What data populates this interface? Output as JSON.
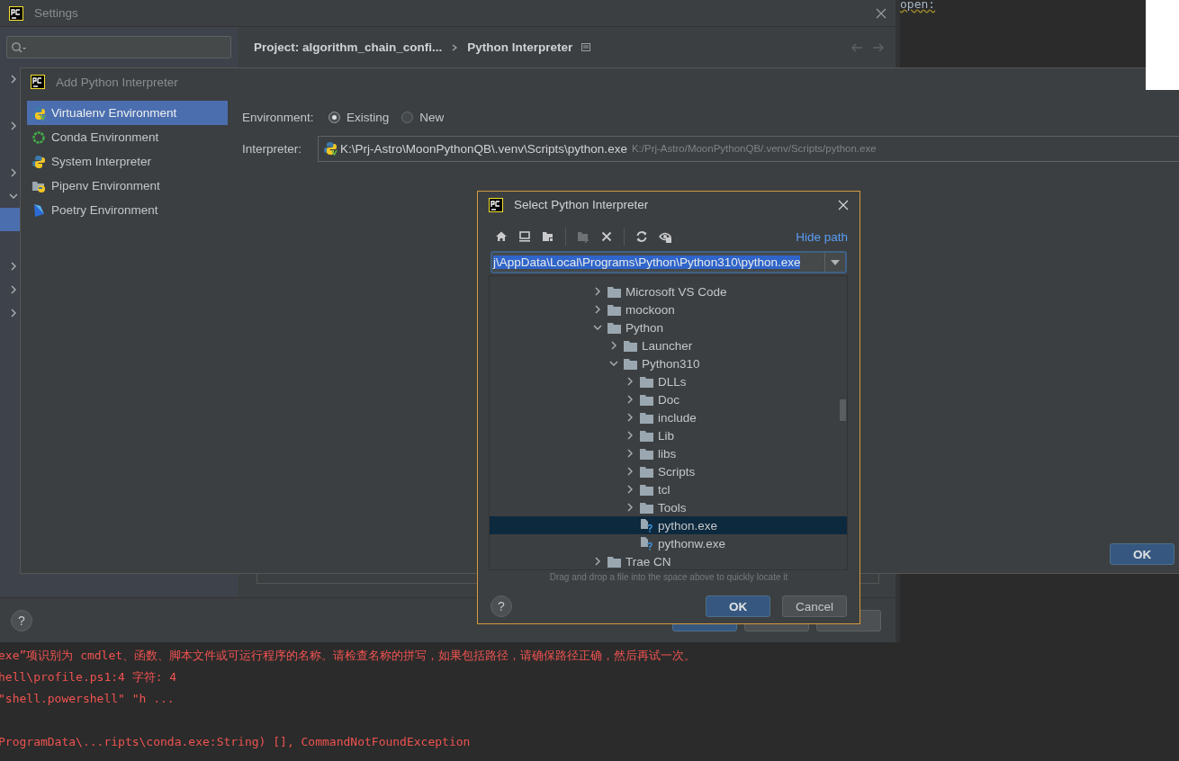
{
  "editor": {
    "code": "open:"
  },
  "terminal": {
    "paragraphs": [
      [
        "exe”项识别为 cmdlet、函数、脚本文件或可运行程序的名称。请检查名称的拼写，如果包括路径，请确保路径正确，然后再试一次。",
        "hell\\profile.ps1:4 字符: 4",
        "\"shell.powershell\" \"h ..."
      ],
      [
        "ProgramData\\...ripts\\conda.exe:String) [], CommandNotFoundException"
      ]
    ]
  },
  "settings": {
    "title": "Settings",
    "breadcrumb": [
      "Project: algorithm_chain_confi...",
      "Python Interpreter"
    ],
    "sidebar": {
      "rows": [
        {
          "kind": "group",
          "expanded": false
        },
        {
          "kind": "leaf",
          "selected": false
        },
        {
          "kind": "group",
          "expanded": false
        },
        {
          "kind": "leaf",
          "selected": false
        },
        {
          "kind": "group",
          "expanded": false
        },
        {
          "kind": "group",
          "expanded": true
        },
        {
          "kind": "leaf",
          "selected": true
        },
        {
          "kind": "leaf",
          "selected": false
        },
        {
          "kind": "group",
          "expanded": false
        },
        {
          "kind": "group",
          "expanded": false
        },
        {
          "kind": "group",
          "expanded": false
        }
      ]
    }
  },
  "add_interpreter": {
    "title": "Add Python Interpreter",
    "environments": [
      {
        "label": "Virtualenv Environment",
        "kind": "virtualenv",
        "selected": true
      },
      {
        "label": "Conda Environment",
        "kind": "conda",
        "selected": false
      },
      {
        "label": "System Interpreter",
        "kind": "system",
        "selected": false
      },
      {
        "label": "Pipenv Environment",
        "kind": "pipenv",
        "selected": false
      },
      {
        "label": "Poetry Environment",
        "kind": "poetry",
        "selected": false
      }
    ],
    "environment_label": "Environment:",
    "environment_options": [
      {
        "label": "Existing",
        "selected": true
      },
      {
        "label": "New",
        "selected": false
      }
    ],
    "interpreter_label": "Interpreter:",
    "interpreter": {
      "value": "K:\\Prj-Astro\\MoonPythonQB\\.venv\\Scripts\\python.exe",
      "path": "K:/Prj-Astro/MoonPythonQB/.venv/Scripts/python.exe"
    },
    "ok": "OK"
  },
  "select_dialog": {
    "title": "Select Python Interpreter",
    "hide_path": "Hide path",
    "path": "j\\AppData\\Local\\Programs\\Python\\Python310\\python.exe",
    "tree": [
      {
        "label": "Microsoft VS Code",
        "kind": "folder",
        "expanded": false,
        "selected": false
      },
      {
        "label": "mockoon",
        "kind": "folder",
        "expanded": false,
        "selected": false
      },
      {
        "label": "Python",
        "kind": "folder",
        "expanded": true,
        "selected": false,
        "children": [
          {
            "label": "Launcher",
            "kind": "folder",
            "expanded": false,
            "selected": false
          },
          {
            "label": "Python310",
            "kind": "folder",
            "expanded": true,
            "selected": false,
            "children": [
              {
                "label": "DLLs",
                "kind": "folder",
                "expanded": false,
                "selected": false
              },
              {
                "label": "Doc",
                "kind": "folder",
                "expanded": false,
                "selected": false
              },
              {
                "label": "include",
                "kind": "folder",
                "expanded": false,
                "selected": false
              },
              {
                "label": "Lib",
                "kind": "folder",
                "expanded": false,
                "selected": false
              },
              {
                "label": "libs",
                "kind": "folder",
                "expanded": false,
                "selected": false
              },
              {
                "label": "Scripts",
                "kind": "folder",
                "expanded": false,
                "selected": false
              },
              {
                "label": "tcl",
                "kind": "folder",
                "expanded": false,
                "selected": false
              },
              {
                "label": "Tools",
                "kind": "folder",
                "expanded": false,
                "selected": false
              },
              {
                "label": "python.exe",
                "kind": "file",
                "selected": true
              },
              {
                "label": "pythonw.exe",
                "kind": "file",
                "selected": false
              }
            ]
          }
        ]
      },
      {
        "label": "Trae CN",
        "kind": "folder",
        "expanded": false,
        "selected": false
      }
    ],
    "hint": "Drag and drop a file into the space above to quickly locate it",
    "help": "?",
    "ok": "OK",
    "cancel": "Cancel"
  }
}
